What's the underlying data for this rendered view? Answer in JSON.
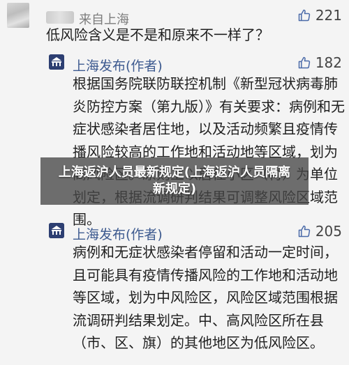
{
  "comments": [
    {
      "user": "来自上海",
      "likes": "221",
      "text": "低风险含义是不是和原来不一样了？"
    },
    {
      "user": "上海发布(作者)",
      "likes": "182",
      "text": "根据国务院联防联控机制《新型冠状病毒肺炎防控方案（第九版）》有关要求：病例和无症状感染者居住地，以及活动频繁且疫情传播风险较高的工作地和活动地等区域，划为高风险区。原则上以居住小区（村）为单位划定，根据流调研判结果可调整风险区域范围。"
    },
    {
      "user": "上海发布(作者)",
      "likes": "205",
      "text": "病例和无症状感染者停留和活动一定时间，且可能具有疫情传播风险的工作地和活动地等区域，划为中风险区，风险区域范围根据流调研判结果划定。中、高风险区所在县（市、区、旗）的其他地区为低风险区。"
    }
  ],
  "overlay_title": "上海返沪人员最新规定(上海返沪人员隔离新规定)",
  "colors": {
    "author_blue": "#3d5a8f",
    "overlay_bg": "#464646"
  },
  "icons": [
    "thumbs-up-icon",
    "gov-logo-icon"
  ]
}
